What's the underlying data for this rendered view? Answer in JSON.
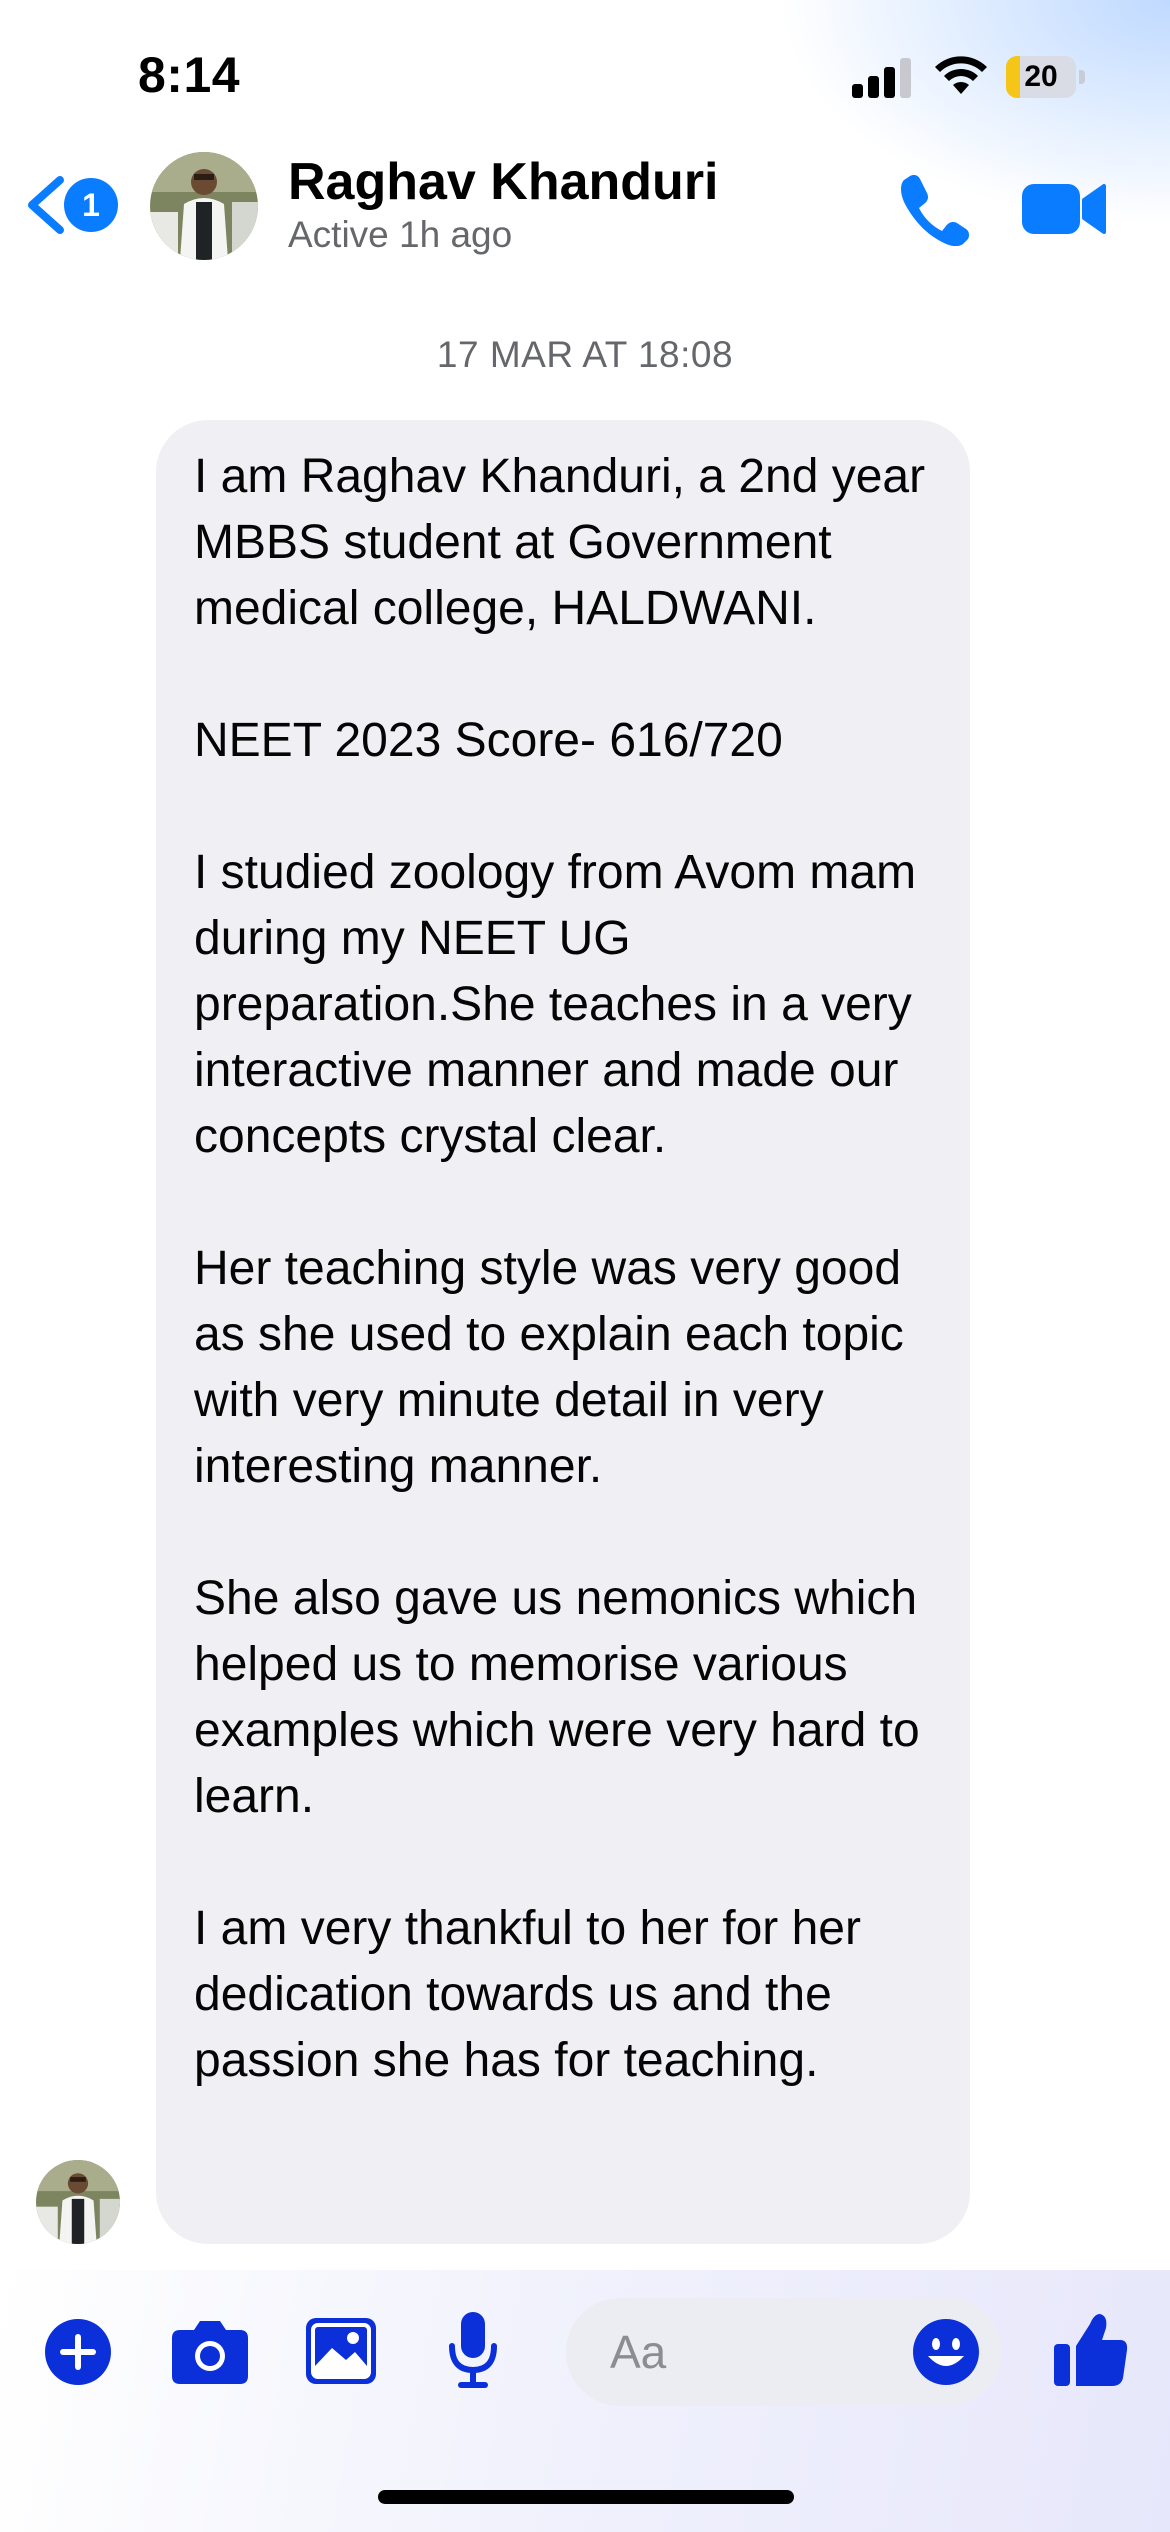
{
  "status_bar": {
    "time": "8:14",
    "battery_level": "20",
    "battery_percent": 20
  },
  "header": {
    "unread_count": "1",
    "contact_name": "Raghav Khanduri",
    "contact_status": "Active 1h ago",
    "icons": {
      "back": "back-chevron-icon",
      "call": "phone-icon",
      "video": "video-camera-icon"
    }
  },
  "conversation": {
    "timestamp": "17 MAR AT 18:08",
    "message": {
      "paragraphs": [
        "I am Raghav Khanduri, a 2nd year MBBS student at Government medical college, HALDWANI.",
        "NEET 2023 Score- 616/720",
        "I studied zoology from Avom mam during my NEET UG preparation.She teaches in a very interactive manner and made our concepts crystal clear.",
        "Her teaching style was very good as she used to explain each topic with very minute detail in very interesting manner.",
        "She also gave us nemonics which helped us to memorise various examples which were very hard to learn.",
        "I am very thankful to her for her dedication towards us and the passion she has for teaching."
      ]
    }
  },
  "composer": {
    "placeholder": "Aa",
    "icons": [
      "plus-icon",
      "camera-icon",
      "gallery-icon",
      "microphone-icon",
      "emoji-icon",
      "thumbs-up-icon"
    ]
  },
  "colors": {
    "accent": "#0a7cff",
    "composer_icon": "#0b2fd8",
    "bubble": "#f0f0f4",
    "secondary_text": "#65676b",
    "battery_fill": "#f5c518"
  }
}
